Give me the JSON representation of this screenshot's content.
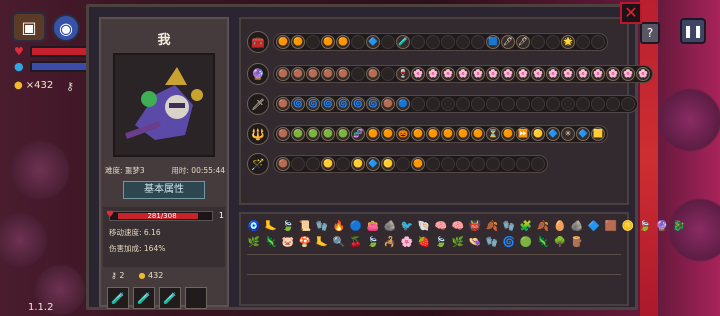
{
  "hud": {
    "coins": "×432",
    "version": "1.1.2",
    "bag_icon": "chest-icon",
    "orb_icon": "orb-icon",
    "key_icon": "key-icon"
  },
  "controls": {
    "pause": "❚❚",
    "help": "?",
    "close": "✕"
  },
  "character": {
    "name": "我",
    "difficulty": "难度: 噩梦3",
    "time": "用时: 00:55:44",
    "tab": "基本属性",
    "hp": {
      "text": "281/308",
      "value": 281,
      "max": 308,
      "extra": "1"
    },
    "move_speed": "移动速度: 6.16",
    "damage_bonus": "伤害加成: 164%",
    "keys": "2",
    "coins": "432",
    "potions": [
      "🧪",
      "🧪",
      "🧪",
      ""
    ]
  },
  "slot_rows": [
    {
      "head": "🧰",
      "slots": [
        "🟠",
        "🟠",
        "",
        "🟠",
        "🟠",
        "",
        "🔷",
        "",
        "🧪",
        "",
        "",
        "",
        "",
        "",
        "🟦",
        "🖊",
        "🖊",
        "",
        "",
        "🌟",
        "",
        ""
      ]
    },
    {
      "head": "🔮",
      "slots": [
        "🟤",
        "🟤",
        "🟤",
        "🟤",
        "🟤",
        "",
        "🟤",
        "",
        "🍷",
        "🌸",
        "🌸",
        "🌸",
        "🌸",
        "🌸",
        "🌸",
        "🌸",
        "🌸",
        "🌸",
        "🌸",
        "🌸",
        "🌸",
        "🌸",
        "🌸",
        "🌸",
        "🌸"
      ]
    },
    {
      "head": "🗡",
      "slots": [
        "🟤",
        "🌀",
        "🌀",
        "🌀",
        "🌀",
        "🌀",
        "🌀",
        "🟤",
        "🔵",
        "",
        "",
        "",
        "",
        "",
        "",
        "",
        "",
        "",
        "",
        "",
        "",
        "",
        "",
        ""
      ]
    },
    {
      "head": "🔱",
      "slots": [
        "🟤",
        "🟢",
        "🟢",
        "🟢",
        "🟢",
        "🧬",
        "🟠",
        "🟠",
        "🎃",
        "🟠",
        "🟠",
        "🟠",
        "🟠",
        "🟠",
        "⏳",
        "🟠",
        "⏩",
        "🟡",
        "🔷",
        "✳",
        "🔷",
        "🟨"
      ]
    },
    {
      "head": "🪄",
      "slots": [
        "🟤",
        "",
        "",
        "🟡",
        "",
        "🟡",
        "🔷",
        "🟡",
        "",
        "🟠",
        "",
        "",
        "",
        "",
        "",
        "",
        "",
        ""
      ]
    }
  ],
  "items": [
    [
      "🧿",
      "🦶",
      "🍃",
      "📜",
      "🧤",
      "🔥",
      "🔵",
      "👛",
      "🪨",
      "🐦",
      "🐚",
      "🧠",
      "🧠",
      "👹",
      "🍂",
      "🧤",
      "🧩",
      "🍂",
      "🥚",
      "🪨",
      "🔷",
      "🟫",
      "🪙",
      "🍃",
      "🔮",
      "🐉"
    ],
    [
      "🌿",
      "🦎",
      "🐷",
      "🍄",
      "🦶",
      "🔍",
      "🍒",
      "🍃",
      "🦂",
      "🌸",
      "🍓",
      "🍃",
      "🌿",
      "👒",
      "🧤",
      "🌀",
      "🟢",
      "🦎",
      "🌳",
      "🪵"
    ]
  ]
}
